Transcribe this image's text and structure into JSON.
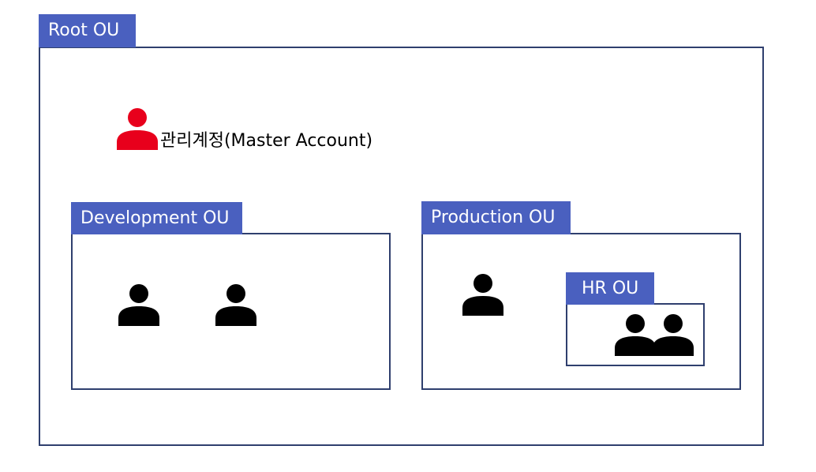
{
  "root": {
    "label": "Root OU"
  },
  "master_account": {
    "label": "관리계정(Master Account)",
    "icon": "user-icon",
    "color": "#e8001c"
  },
  "development": {
    "label": "Development OU",
    "member_icons": [
      "user-icon",
      "user-icon"
    ]
  },
  "production": {
    "label": "Production OU",
    "member_icons": [
      "user-icon"
    ],
    "child": {
      "label": "HR OU",
      "member_icons": [
        "users-group-icon"
      ]
    }
  },
  "colors": {
    "tag_background": "#4a60bf",
    "box_border": "#2f3f6e",
    "user_icon": "#000000"
  }
}
